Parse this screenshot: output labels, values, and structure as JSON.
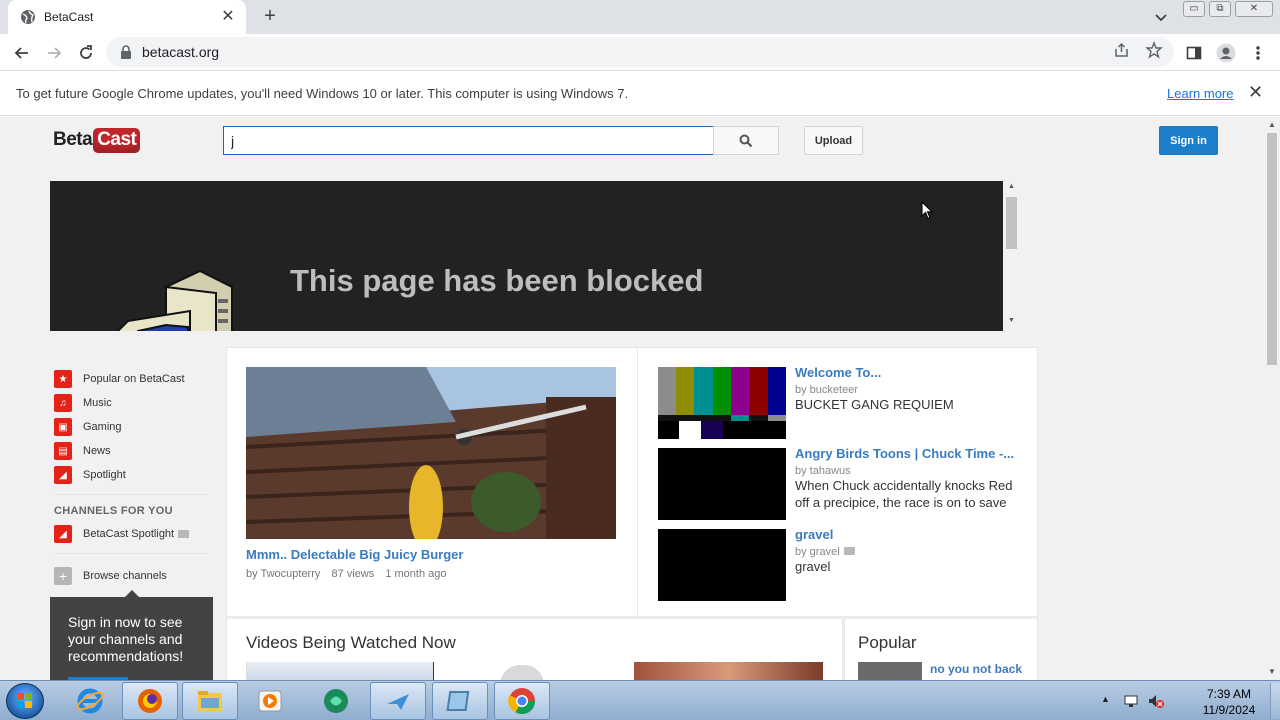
{
  "browser": {
    "tab_title": "BetaCast",
    "url": "betacast.org",
    "infobar_message": "To get future Google Chrome updates, you'll need Windows 10 or later. This computer is using Windows 7.",
    "infobar_link": "Learn more"
  },
  "site": {
    "logo_beta": "Beta",
    "logo_cast": "Cast",
    "search_value": "j",
    "upload_label": "Upload",
    "signin_label": "Sign in",
    "brand_color": "#c0272d",
    "accent_color": "#1b7fcc"
  },
  "banner": {
    "title": "This page has been blocked"
  },
  "guide": {
    "items": [
      {
        "label": "Popular on BetaCast",
        "icon": "star-icon"
      },
      {
        "label": "Music",
        "icon": "headphones-icon"
      },
      {
        "label": "Gaming",
        "icon": "gamepad-icon"
      },
      {
        "label": "News",
        "icon": "news-icon"
      },
      {
        "label": "Spotlight",
        "icon": "spotlight-icon"
      }
    ],
    "channels_heading": "CHANNELS FOR YOU",
    "channel_item": "BetaCast Spotlight",
    "browse_label": "Browse channels",
    "promo_text": "Sign in now to see your channels and recommendations!"
  },
  "featured": {
    "title": "Mmm.. Delectable Big Juicy Burger",
    "author": "by Twocupterry",
    "views": "87 views",
    "age": "1 month ago"
  },
  "side_videos": [
    {
      "title": "Welcome To...",
      "by": "by bucketeer",
      "desc": "BUCKET GANG REQUIEM"
    },
    {
      "title": "Angry Birds Toons | Chuck Time -...",
      "by": "by tahawus",
      "desc": "When Chuck accidentally knocks Red off a precipice, the race is on to save"
    },
    {
      "title": "gravel",
      "by": "by gravel",
      "desc": "gravel"
    }
  ],
  "sections": {
    "watched_now": "Videos Being Watched Now",
    "popular": "Popular",
    "popular_first": "no you not back"
  },
  "taskbar": {
    "time": "7:39 AM",
    "date": "11/9/2024"
  }
}
